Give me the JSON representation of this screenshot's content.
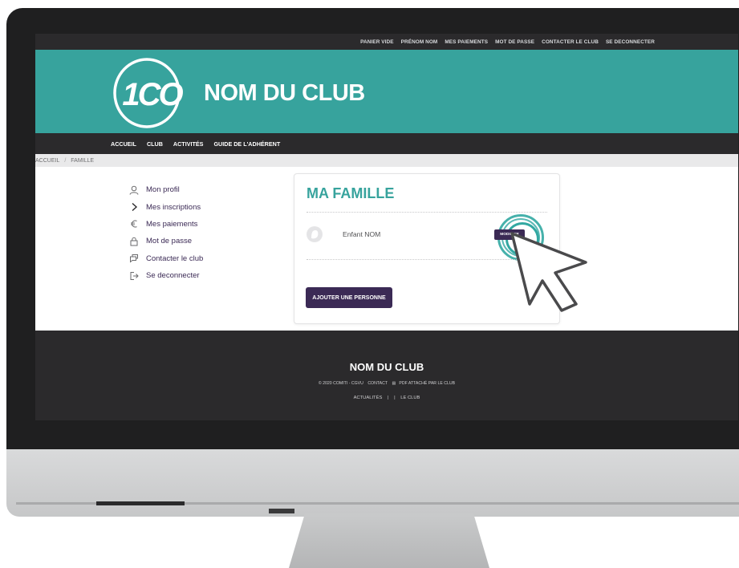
{
  "topbar": {
    "links": [
      "PANIER VIDE",
      "PRÉNOM NOM",
      "MES PAIEMENTS",
      "MOT DE PASSE",
      "CONTACTER LE CLUB",
      "SE DECONNECTER"
    ]
  },
  "header": {
    "logo_text": "1CO",
    "club_name": "NOM DU CLUB"
  },
  "mainnav": {
    "items": [
      "ACCUEIL",
      "CLUB",
      "ACTIVITÉS",
      "GUIDE DE L'ADHÉRENT"
    ]
  },
  "breadcrumb": {
    "home": "ACCUEIL",
    "separator": "/",
    "current": "FAMILLE"
  },
  "sidebar": {
    "items": [
      {
        "label": "Mon profil",
        "icon": "user-icon"
      },
      {
        "label": "Mes inscriptions",
        "icon": "chevron-right-icon"
      },
      {
        "label": "Mes paiements",
        "icon": "euro-icon"
      },
      {
        "label": "Mot de passe",
        "icon": "lock-icon"
      },
      {
        "label": "Contacter le club",
        "icon": "chat-icon"
      },
      {
        "label": "Se deconnecter",
        "icon": "logout-icon"
      }
    ]
  },
  "family": {
    "title": "MA FAMILLE",
    "members": [
      {
        "name": "Enfant NOM",
        "action_label": "MODIFIER"
      }
    ],
    "add_label": "AJOUTER UNE PERSONNE"
  },
  "footer": {
    "title": "NOM DU CLUB",
    "copyright": "© 2020 COMITI - CGVU",
    "contact": "CONTACT",
    "pdf_link": "PDF ATTACHÉ PAR LE CLUB",
    "news": "ACTUALITÉS",
    "divider": "|",
    "club": "LE CLUB"
  },
  "colors": {
    "accent": "#37a39d",
    "brand_dark": "#3b2a55",
    "nav_dark": "#2b2a2c"
  }
}
